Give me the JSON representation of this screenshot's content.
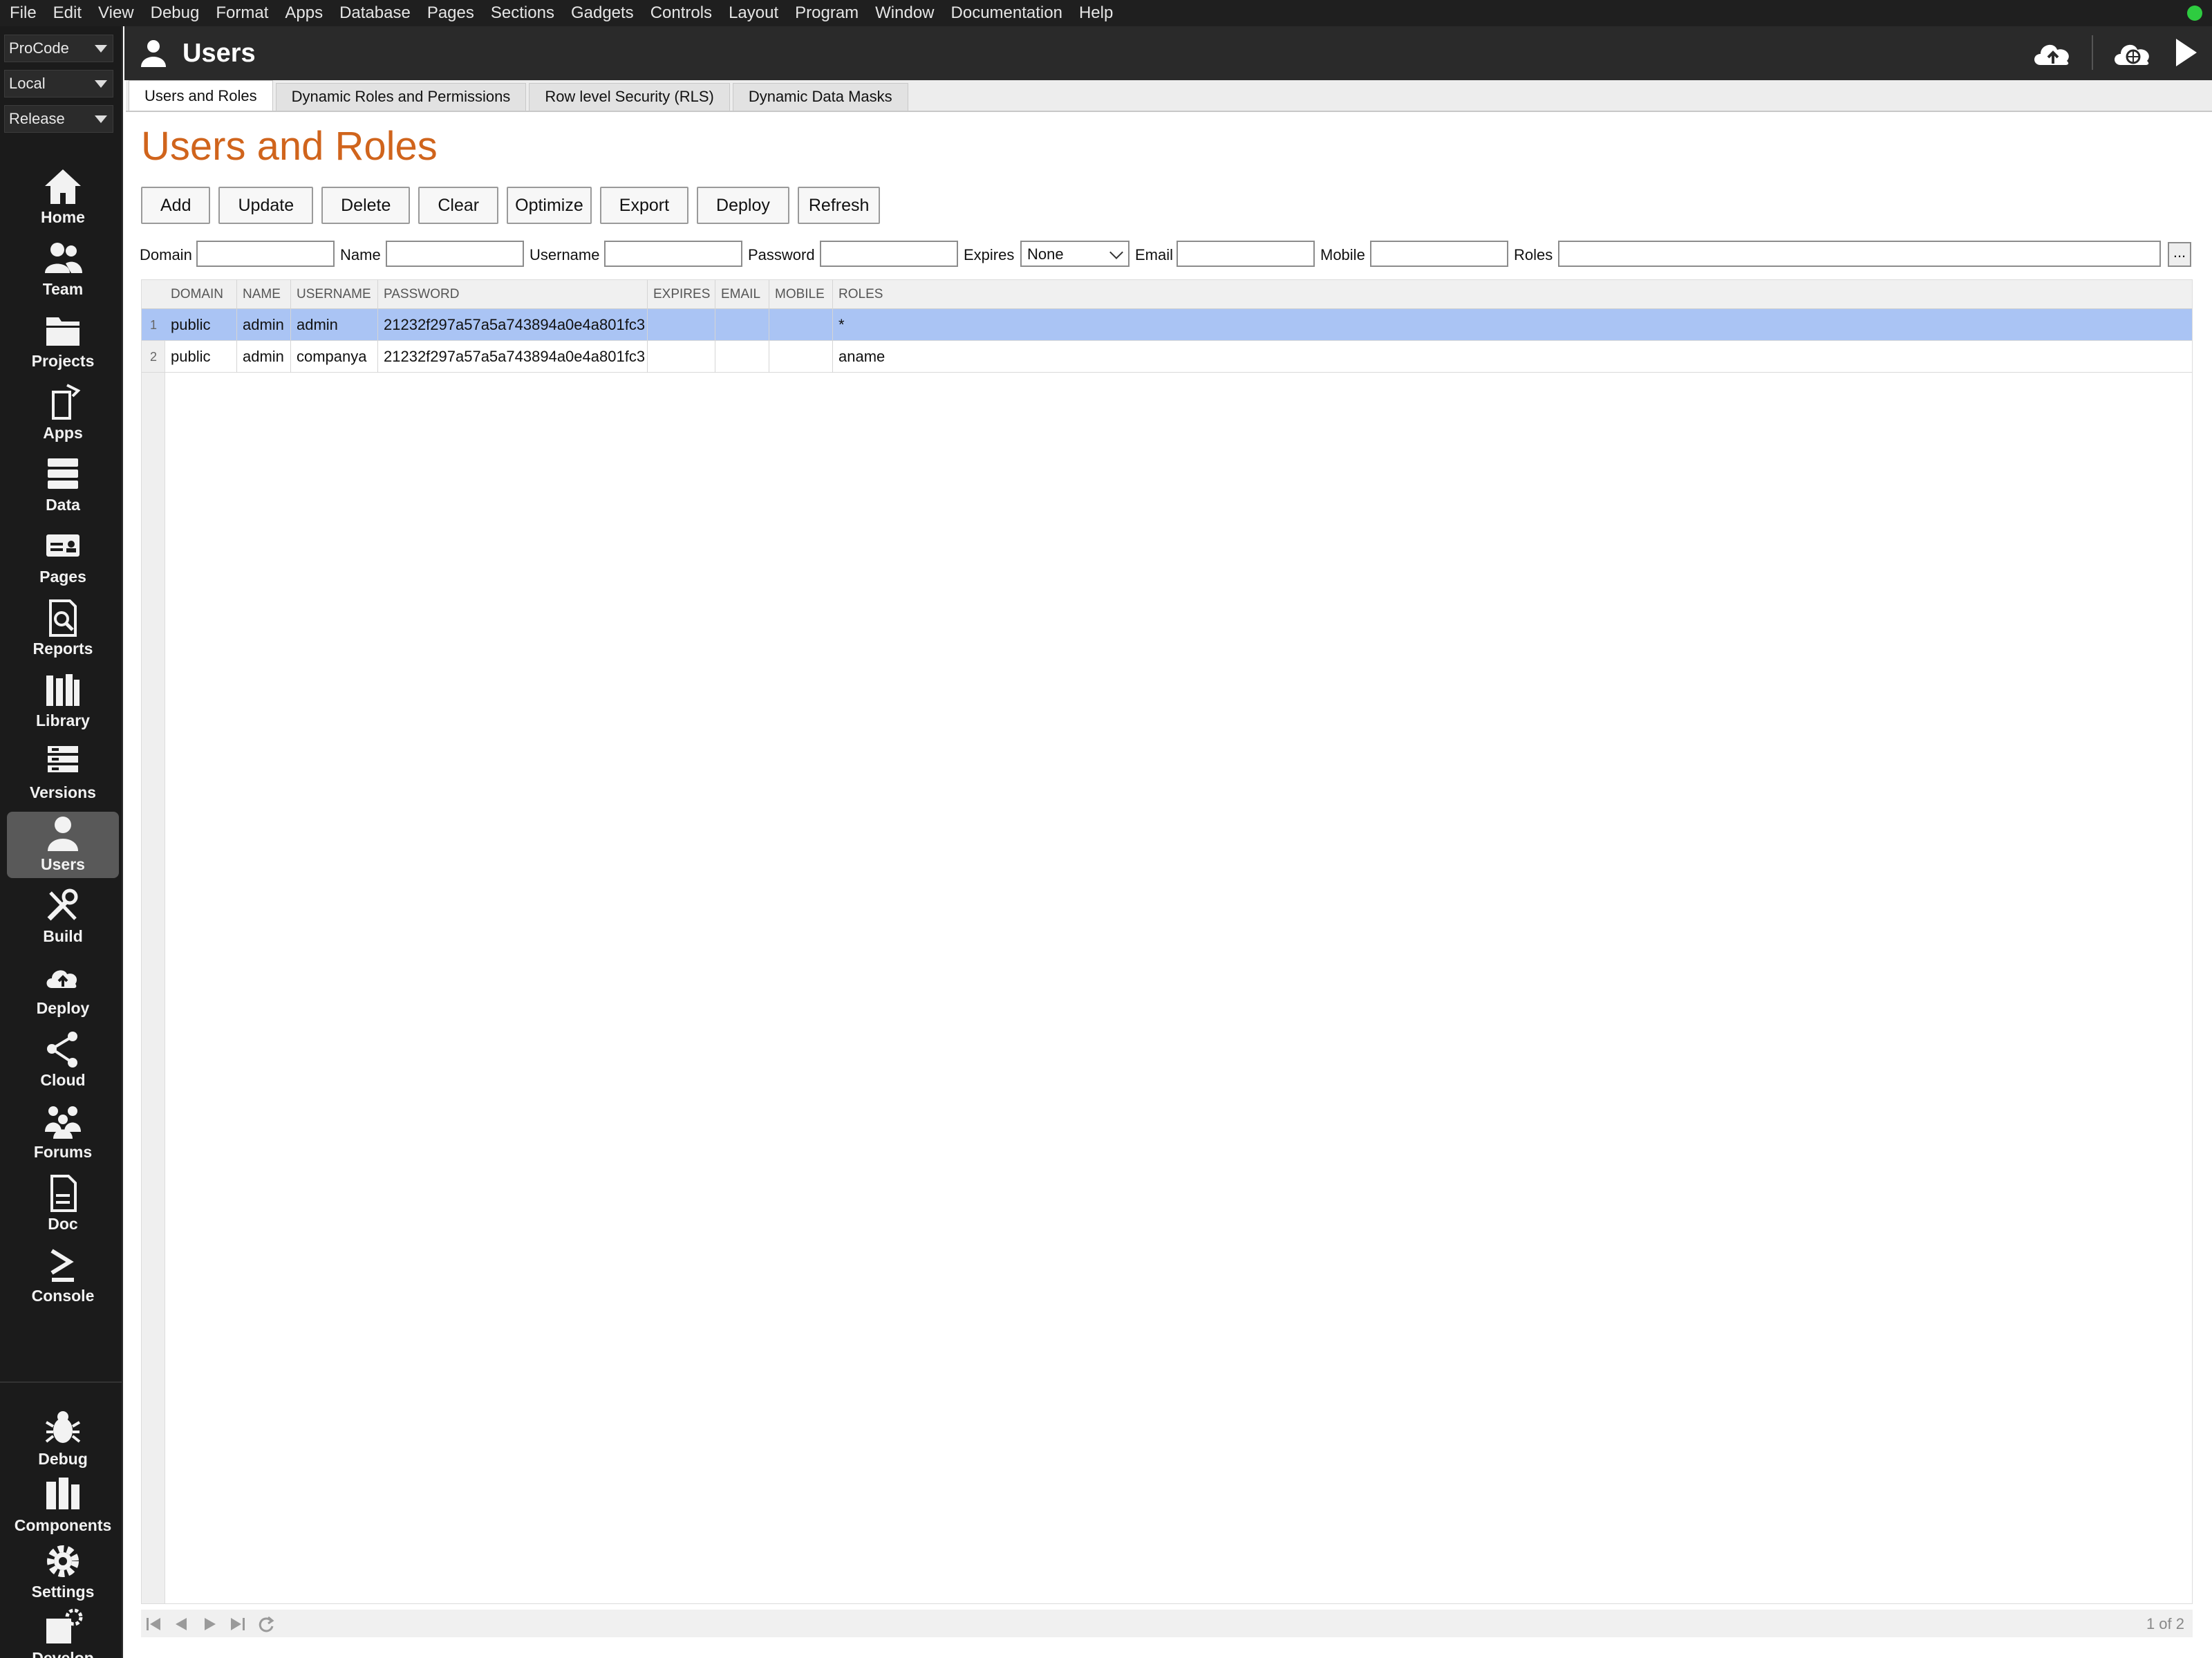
{
  "menu": [
    "File",
    "Edit",
    "View",
    "Debug",
    "Format",
    "Apps",
    "Database",
    "Pages",
    "Sections",
    "Gadgets",
    "Controls",
    "Layout",
    "Program",
    "Window",
    "Documentation",
    "Help"
  ],
  "selectors": [
    {
      "value": "ProCode"
    },
    {
      "value": "Local"
    },
    {
      "value": "Release"
    }
  ],
  "sidebar": {
    "items": [
      {
        "label": "Home",
        "icon": "home-icon"
      },
      {
        "label": "Team",
        "icon": "team-icon"
      },
      {
        "label": "Projects",
        "icon": "folder-icon"
      },
      {
        "label": "Apps",
        "icon": "apps-icon"
      },
      {
        "label": "Data",
        "icon": "database-icon"
      },
      {
        "label": "Pages",
        "icon": "pages-icon"
      },
      {
        "label": "Reports",
        "icon": "reports-icon"
      },
      {
        "label": "Library",
        "icon": "library-icon"
      },
      {
        "label": "Versions",
        "icon": "versions-icon"
      },
      {
        "label": "Users",
        "icon": "user-icon",
        "active": true
      },
      {
        "label": "Build",
        "icon": "build-icon"
      },
      {
        "label": "Deploy",
        "icon": "cloud-upload-icon"
      },
      {
        "label": "Cloud",
        "icon": "share-icon"
      },
      {
        "label": "Forums",
        "icon": "forums-icon"
      },
      {
        "label": "Doc",
        "icon": "document-icon"
      },
      {
        "label": "Console",
        "icon": "console-icon"
      }
    ],
    "bottom_items": [
      {
        "label": "Debug",
        "icon": "bug-icon"
      },
      {
        "label": "Components",
        "icon": "components-icon"
      },
      {
        "label": "Settings",
        "icon": "gear-icon"
      },
      {
        "label": "Develop",
        "icon": "develop-icon"
      }
    ]
  },
  "header": {
    "title": "Users"
  },
  "tabs": [
    {
      "label": "Users and Roles",
      "active": true
    },
    {
      "label": "Dynamic Roles and Permissions"
    },
    {
      "label": "Row level Security (RLS)"
    },
    {
      "label": "Dynamic Data Masks"
    }
  ],
  "page": {
    "title": "Users and Roles"
  },
  "buttons": [
    "Add",
    "Update",
    "Delete",
    "Clear",
    "Optimize",
    "Export",
    "Deploy",
    "Refresh"
  ],
  "filters": {
    "domain_label": "Domain",
    "name_label": "Name",
    "username_label": "Username",
    "password_label": "Password",
    "expires_label": "Expires",
    "expires_value": "None",
    "email_label": "Email",
    "mobile_label": "Mobile",
    "roles_label": "Roles",
    "more_label": "..."
  },
  "table": {
    "columns": [
      "DOMAIN",
      "NAME",
      "USERNAME",
      "PASSWORD",
      "EXPIRES",
      "EMAIL",
      "MOBILE",
      "ROLES"
    ],
    "rows": [
      {
        "num": "1",
        "cells": [
          "public",
          "admin",
          "admin",
          "21232f297a57a5a743894a0e4a801fc3",
          "",
          "",
          "",
          "*"
        ],
        "selected": true
      },
      {
        "num": "2",
        "cells": [
          "public",
          "admin",
          "companya",
          "21232f297a57a5a743894a0e4a801fc3",
          "",
          "",
          "",
          "aname"
        ]
      }
    ]
  },
  "pager": {
    "status": "1 of 2"
  },
  "colors": {
    "accent": "#d0641c",
    "selected_row": "#aac4f4",
    "status_dot": "#2ecc40"
  }
}
